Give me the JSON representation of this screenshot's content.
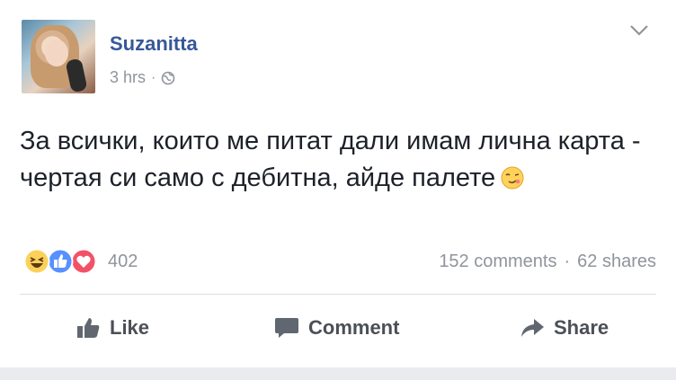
{
  "post": {
    "author": "Suzanitta",
    "time": "3 hrs",
    "separator": "·",
    "text": "За всички, които ме питат дали имам лична карта - чертая си само с дебитна, айде палете",
    "reactions_count": "402",
    "comments": "152 comments",
    "shares": "62 shares"
  },
  "actions": {
    "like": "Like",
    "comment": "Comment",
    "share": "Share"
  },
  "icons": {
    "privacy": "globe-icon",
    "menu": "chevron-down-icon",
    "reactions": [
      "haha-icon",
      "like-icon",
      "love-icon"
    ],
    "text_emoji": "wink-emoji-icon"
  },
  "colors": {
    "author": "#365899",
    "secondary": "#90949c",
    "like_blue": "#5890ff",
    "love_red": "#f25268",
    "haha_yellow": "#fcd15a"
  }
}
